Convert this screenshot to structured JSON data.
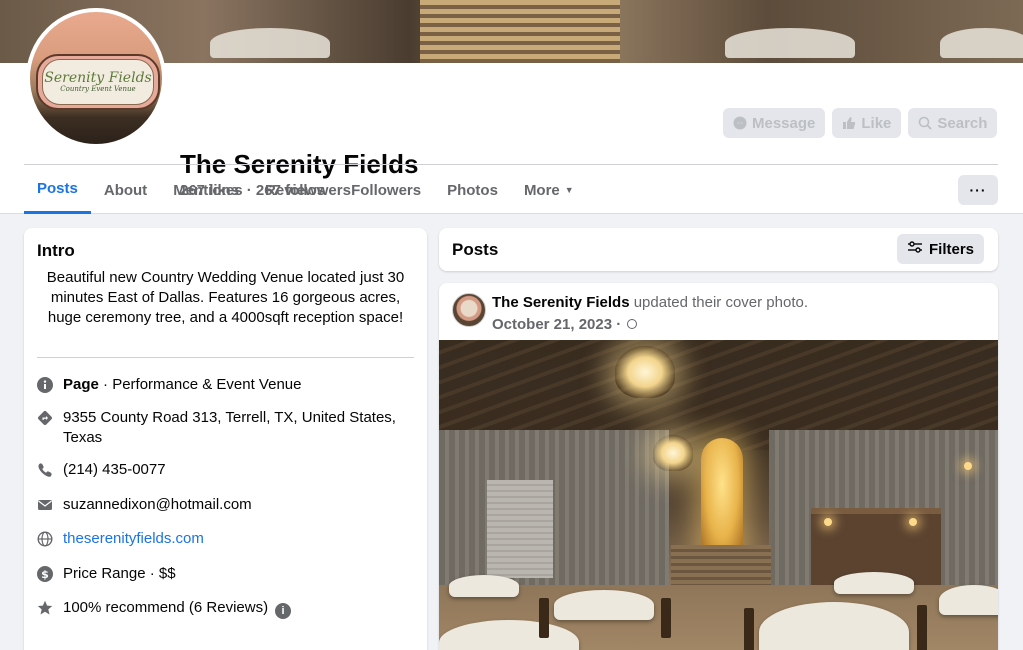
{
  "page": {
    "name": "The Serenity Fields",
    "stats": "267 likes · 267 followers",
    "avatar_brand": "Serenity Fields",
    "avatar_subtitle": "Country Event Venue"
  },
  "actions": {
    "message": "Message",
    "like": "Like",
    "search": "Search"
  },
  "tabs": [
    {
      "label": "Posts",
      "active": true
    },
    {
      "label": "About"
    },
    {
      "label": "Mentions"
    },
    {
      "label": "Reviews"
    },
    {
      "label": "Followers"
    },
    {
      "label": "Photos"
    },
    {
      "label": "More"
    }
  ],
  "more_menu_label": "···",
  "intro": {
    "title": "Intro",
    "bio": "Beautiful new Country Wedding Venue located just 30 minutes East of Dallas. Features 16 gorgeous acres, huge ceremony tree, and a 4000sqft reception space!",
    "page_label": "Page",
    "category": " · Performance & Event Venue",
    "address": "9355 County Road 313, Terrell, TX, United States, Texas",
    "phone": "(214) 435-0077",
    "email": "suzannedixon@hotmail.com",
    "website": "theserenityfields.com",
    "price_range": "Price Range · $$",
    "recommend": "100% recommend (6 Reviews)"
  },
  "posts_header": {
    "title": "Posts",
    "filters": "Filters"
  },
  "post": {
    "author": "The Serenity Fields",
    "action": " updated their cover photo.",
    "date": "October 21, 2023 ·"
  },
  "colors": {
    "accent": "#1b74e4",
    "secondary_text": "#65676b",
    "background": "#f0f2f5"
  }
}
